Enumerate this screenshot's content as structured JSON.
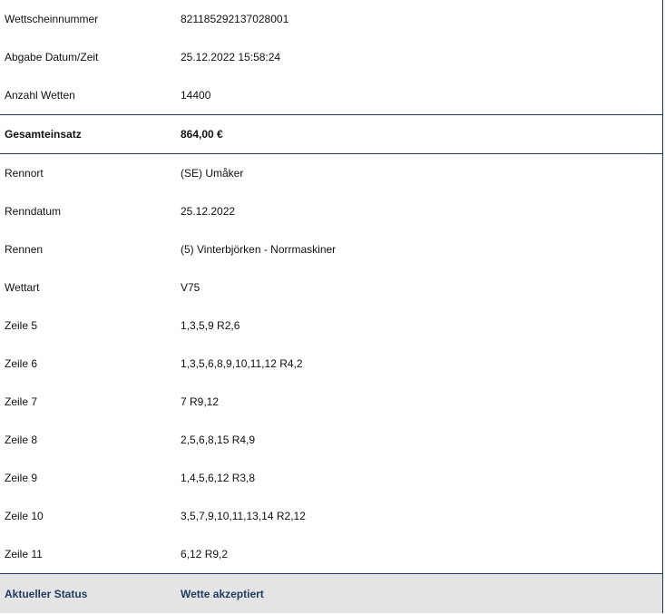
{
  "ticket": {
    "rows_top": [
      {
        "label": "Wettscheinnummer",
        "value": "821185292137028001"
      },
      {
        "label": "Abgabe Datum/Zeit",
        "value": "25.12.2022 15:58:24"
      },
      {
        "label": "Anzahl Wetten",
        "value": "14400"
      }
    ],
    "total": {
      "label": "Gesamteinsatz",
      "value": "864,00 €"
    },
    "rows_details": [
      {
        "label": "Rennort",
        "value": "(SE) Umåker"
      },
      {
        "label": "Renndatum",
        "value": "25.12.2022"
      },
      {
        "label": "Rennen",
        "value": "(5) Vinterbjörken - Norrmaskiner"
      },
      {
        "label": "Wettart",
        "value": "V75"
      },
      {
        "label": "Zeile 5",
        "value": "1,3,5,9 R2,6"
      },
      {
        "label": "Zeile 6",
        "value": "1,3,5,6,8,9,10,11,12 R4,2"
      },
      {
        "label": "Zeile 7",
        "value": "7 R9,12"
      },
      {
        "label": "Zeile 8",
        "value": "2,5,6,8,15 R4,9"
      },
      {
        "label": "Zeile 9",
        "value": "1,4,5,6,12 R3,8"
      },
      {
        "label": "Zeile 10",
        "value": "3,5,7,9,10,11,13,14 R2,12"
      },
      {
        "label": "Zeile 11",
        "value": "6,12 R9,2"
      }
    ],
    "status": {
      "label": "Aktueller Status",
      "value": "Wette akzeptiert"
    }
  },
  "colors": {
    "border": "#1e3a5f",
    "status_bg": "#e4e4e4",
    "status_text": "#1e3a5f"
  }
}
